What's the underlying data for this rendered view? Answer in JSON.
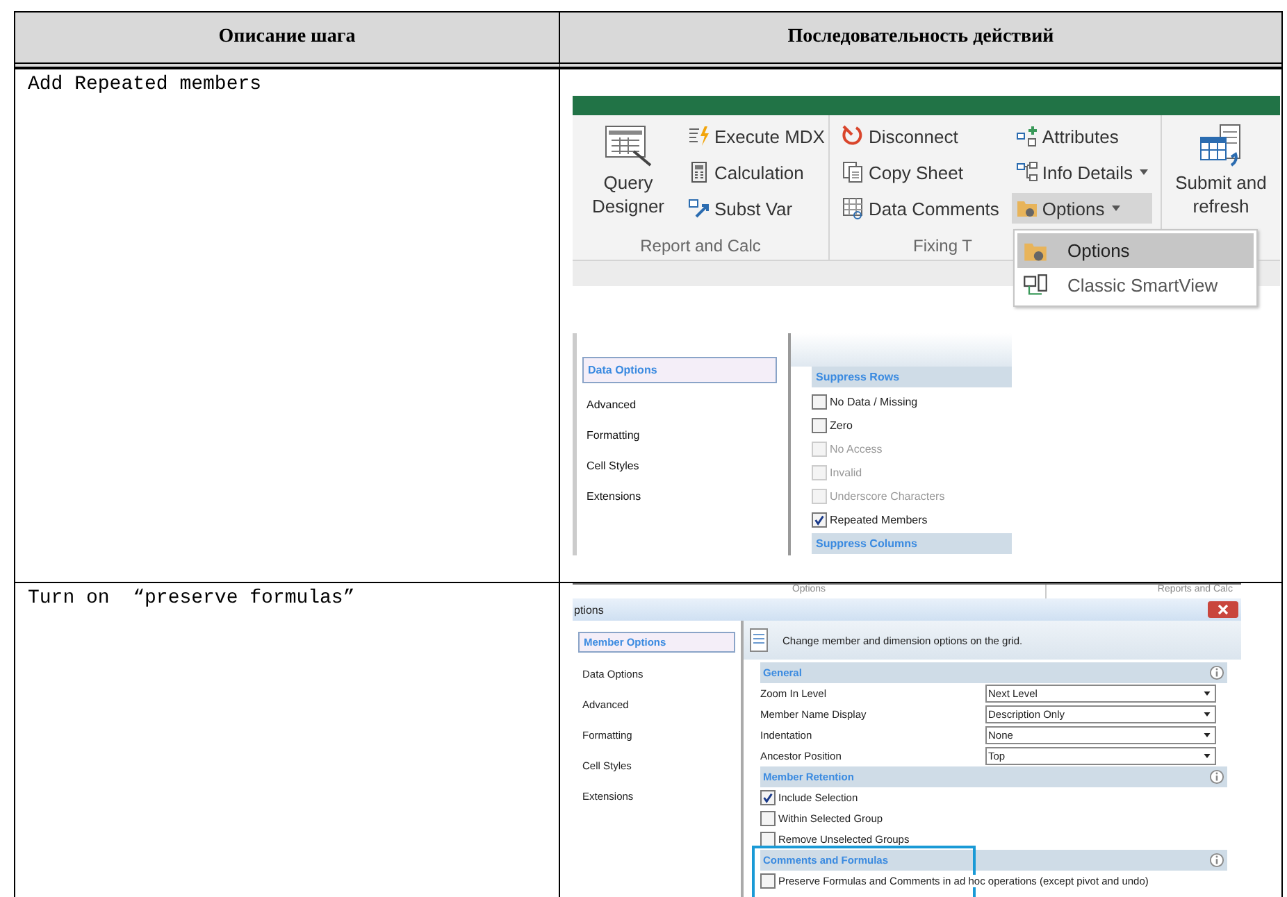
{
  "table": {
    "columns": [
      "Описание шага",
      "Последовательность действий"
    ],
    "rows": [
      {
        "description": "Add Repeated members",
        "ribbon": {
          "report_calc": {
            "large": "Query Designer",
            "small": [
              "Execute MDX",
              "Calculation",
              "Subst Var"
            ],
            "label": "Report and Calc"
          },
          "fixing": {
            "col1": [
              "Disconnect",
              "Copy Sheet",
              "Data Comments"
            ],
            "col2": [
              {
                "label": "Attributes",
                "dropdown": false,
                "highlighted": false
              },
              {
                "label": "Info Details",
                "dropdown": true,
                "highlighted": false
              },
              {
                "label": "Options",
                "dropdown": true,
                "highlighted": true
              }
            ],
            "label": "Fixing T"
          },
          "submit": "Submit and refresh",
          "menu": [
            {
              "label": "Options",
              "selected": true
            },
            {
              "label": "Classic SmartView",
              "selected": false
            }
          ]
        },
        "data_options_panel": {
          "nav": [
            {
              "label": "Data Options",
              "selected": true
            },
            {
              "label": "Advanced",
              "selected": false
            },
            {
              "label": "Formatting",
              "selected": false
            },
            {
              "label": "Cell Styles",
              "selected": false
            },
            {
              "label": "Extensions",
              "selected": false
            }
          ],
          "section": "Suppress Rows",
          "options": [
            {
              "label": "No Data / Missing",
              "checked": false,
              "disabled": false
            },
            {
              "label": "Zero",
              "checked": false,
              "disabled": false
            },
            {
              "label": "No Access",
              "checked": false,
              "disabled": true
            },
            {
              "label": "Invalid",
              "checked": false,
              "disabled": true
            },
            {
              "label": "Underscore Characters",
              "checked": false,
              "disabled": true
            },
            {
              "label": "Repeated Members",
              "checked": true,
              "disabled": false
            }
          ],
          "next_section": "Suppress Columns"
        }
      },
      {
        "description": "Turn on  “preserve formulas”",
        "options_dialog": {
          "ribbon_tabs": [
            "Options",
            "Reports and Calc"
          ],
          "title": "ptions",
          "nav": [
            {
              "label": "Member Options",
              "selected": true
            },
            {
              "label": "Data Options",
              "selected": false
            },
            {
              "label": "Advanced",
              "selected": false
            },
            {
              "label": "Formatting",
              "selected": false
            },
            {
              "label": "Cell Styles",
              "selected": false
            },
            {
              "label": "Extensions",
              "selected": false
            }
          ],
          "header": "Change member and dimension options on the grid.",
          "sections": [
            {
              "title": "General",
              "kind": "selects",
              "items": [
                {
                  "label": "Zoom In Level",
                  "value": "Next Level"
                },
                {
                  "label": "Member Name Display",
                  "value": "Description Only"
                },
                {
                  "label": "Indentation",
                  "value": "None"
                },
                {
                  "label": "Ancestor Position",
                  "value": "Top"
                }
              ]
            },
            {
              "title": "Member Retention",
              "kind": "checks",
              "highlighted": false,
              "items": [
                {
                  "label": "Include Selection",
                  "checked": true
                },
                {
                  "label": "Within Selected Group",
                  "checked": false
                },
                {
                  "label": "Remove Unselected Groups",
                  "checked": false
                }
              ]
            },
            {
              "title": "Comments and Formulas",
              "kind": "checks",
              "highlighted": true,
              "items": [
                {
                  "label": "Preserve Formulas and Comments in ad hoc operations (except pivot and undo)",
                  "checked": false
                }
              ]
            }
          ]
        }
      }
    ]
  }
}
